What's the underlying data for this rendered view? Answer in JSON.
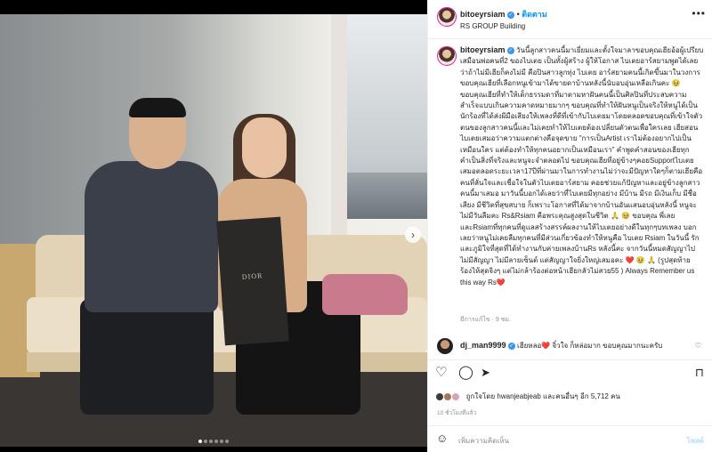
{
  "header": {
    "username": "bitoeyrsiam",
    "dot": "•",
    "follow_label": "ติดตาม",
    "location": "RS GROUP Building",
    "more": "•••"
  },
  "media": {
    "bag_logo": "DIOR",
    "next_glyph": "›",
    "carousel_total": 6,
    "carousel_active": 1
  },
  "caption": {
    "username": "bitoeyrsiam",
    "text": "วันนี้ลูกสาวคนนี้มาเยี่ยมและตั้งใจมาลาขอบคุณเฮียอ้อผู้เปรียบเสมือนพ่อคนที่2 ของไบเตย เป็นทั้งผู้สร้าง ผู้ให้โอกาส ไบเตยอาร์สยามพูดได้เลยว่าถ้าไม่มีเฮียก็คงไม่มี คือปินสาวลูกทุ่ง ไบเตย อาร์สยามคนนี้เกิดขึ้นมาในวงการ ขอบคุณเฮียที่เลือกหนูเข้ามาได้ขายดาบ้านหลังนี้นับอบอุ่นเหลือเกินคะ 🥹 ขอบคุณเฮียที่ทำให้เด็กธรรมดาที่มาตามหาฝันคนนี้เป็นศิลปินที่ประสบความสำเร็จแบบเกินความคาดหมายมากๆ ขอบคุณที่ทำให้ฝันหนูเป็นจริงให้หนูได้เป็นนักร้องที่ได้ส่งผีมือเสียงให้เพลงที่ดีที่เข้ากับไบเตยมาโดยตลอดขอบคุณที่เข้าใจตัวตนของลูกสาวคนนี้และไม่เคยทำให้ไบเตยต้องเปลี่ยนตัวตนเพื่อใครเลย เฮียสอนไบเตยเสมอว่าความแตกต่างคือจุดขาย \"การเป็นArtist เราไม่ต้องอยากไปเป็นเหมือนใคร แต่ต้องทำให้ทุกคนอยากเป็นเหมือนเรา\" คำพูดคำสอนของเฮียทุกคำเป็นสิ่งที่จริงและหนูจะจำตลอดไป ขอบคุณเฮียที่อยู่ข้างๆคอยSupportไบเตยเสมอตลอดระยะเวลา17ปีที่ผ่านมาในการทำงานไม่ว่าจะมีปัญหาใดๆก็ตามเฮียคือคนที่ลั่นใจและเชื่อใจในตัวไบเตยอาร์สยาม คอยช่วยแก้ปัญหาและอยู่ข้างลูกสาวคนนี้มาเสมอ มาวันนี้บอกได้เลยว่าที่ไบเตยมีทุกอย่าง มีบ้าน มีรถ มีเงินเก็บ มีชื่อเสียง มีชีวิตที่สุขสบาย ก็เพราะโอกาสที่ได้มาจากบ้านอันแสนอบอุ่นหลังนี้ หนูจะไม่มีวันลืมคะ Rs&Rsiam คือพระคุณสูงสุดในชีวิต 🙏 🥹 ขอบคุณ พี่เลย และRsiamที่ทุกคนที่ดูแลสร้างสรรค์ผลงานให้ไบเตยอย่างดีในทุกๆบทเพลง บอกเลยว่าหนูไม่เคยลืมทุกคนที่มีส่วนเกี่ยวข้องทำให้หนูคือ ไบเตย Rsiam ในวันนี้ รักและภูมิใจที่สุดที่ได้ทำงานกับค่ายเพลงบ้านRs หลังนี้คะ จากวันนี้หมดสัญญาไป ไม่มีสัญญา ไม่มีลายเซ็นต์ แต่สัญญาใจยิ่งใหญ่เสมอคะ ❤️ 🥹 🙏 (รูปสุดท้ายร้องไห้สุดจิงๆ แต่ไม่กล้าร้องต่อหน้าเฮียกลัวไม่สวย55 ) Always Remember us this way Rs❤️",
    "meta": "มีการแก้ไข · 9 ชม."
  },
  "comment": {
    "username": "dj_man9999",
    "text": "เฮียหลอ❤️ จิ๋วใจ ก็หล่อมาก ขอบคุณมากนะครับ"
  },
  "likes": {
    "text": "ถูกใจโดย hwanjeabjeab และคนอื่นๆ อีก 5,712 คน"
  },
  "time": "10 ชั่วโมงที่แล้ว",
  "comment_box": {
    "placeholder": "เพิ่มความคิดเห็น",
    "post_label": "โพสต์"
  },
  "colors": {
    "link": "#0095f6",
    "verified": "#3897f0",
    "muted": "#8e8e8e"
  }
}
